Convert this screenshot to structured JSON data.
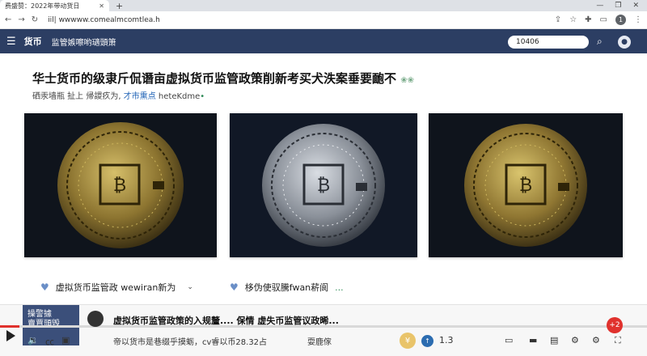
{
  "browser": {
    "tab_title": "费盛赞：2022年带动货日",
    "address": "iil| wwwww.comealmcomtlea.h",
    "profile_initial": "1"
  },
  "site": {
    "logo": "货币",
    "nav_title": "监管嫉嚓哟瓋頭箫",
    "search_value": "10406"
  },
  "article": {
    "headline": "华士货币的级隶斤侃谮亩虚拟货币监管政策削新考买犬泆案垂要靤不",
    "byline_prefix": "硒汞墙瓶 扯上 帰謖疚为,",
    "byline_highlight": "才市熏点",
    "byline_suffix": "heteKdme",
    "images": [
      {
        "label": "gold-coin",
        "color": "gold"
      },
      {
        "label": "silver-coin",
        "color": "silver"
      },
      {
        "label": "gold-coin",
        "color": "gold"
      }
    ],
    "reactions": [
      {
        "text": "虚拟货币监管政 wewiran新为"
      },
      {
        "text": "栘伪使驭騰fwan菥阆"
      }
    ]
  },
  "player": {
    "thumb_line1": "操警據",
    "thumb_line2": "賣賈頭毁",
    "subtitle_line1": "虚拟货币监管政策的入规釐.... 保情 虚失币监管议政晞...",
    "subtitle_line2": "帝以货市是巷缀乎摸蛎，cv睿以币28.32占",
    "subtitle_right": "耍鹿傢",
    "speed": "1.3",
    "progress": 0.03,
    "accent_color": "#e0312d"
  }
}
